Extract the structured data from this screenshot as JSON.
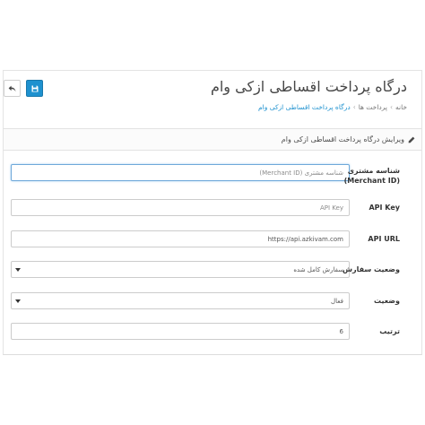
{
  "header": {
    "title": "درگاه پرداخت اقساطی ازکی وام",
    "back_icon": "reply-icon",
    "save_icon": "floppy-icon",
    "accent_color": "#1e91cf"
  },
  "breadcrumb": {
    "items": [
      "خانه",
      "پرداخت ها",
      "درگاه پرداخت اقساطی ازکی وام"
    ],
    "separator": "›"
  },
  "panel": {
    "title": "ویرایش درگاه پرداخت اقساطی ازکی وام",
    "icon": "pencil-icon"
  },
  "form": {
    "merchant_id": {
      "label_line1": "شناسه مشتری",
      "label_line2": "(Merchant ID)",
      "placeholder": "شناسه مشتری (Merchant ID)",
      "value": ""
    },
    "api_key": {
      "label": "API Key",
      "placeholder": "API Key",
      "value": ""
    },
    "api_url": {
      "label": "API URL",
      "value": "https://api.azkivam.com"
    },
    "order_status": {
      "label": "وضعیت سفارش",
      "selected": "سفارش کامل شده"
    },
    "status": {
      "label": "وضعیت",
      "selected": "فعال"
    },
    "sort_order": {
      "label": "ترتیب",
      "value": "6"
    }
  }
}
